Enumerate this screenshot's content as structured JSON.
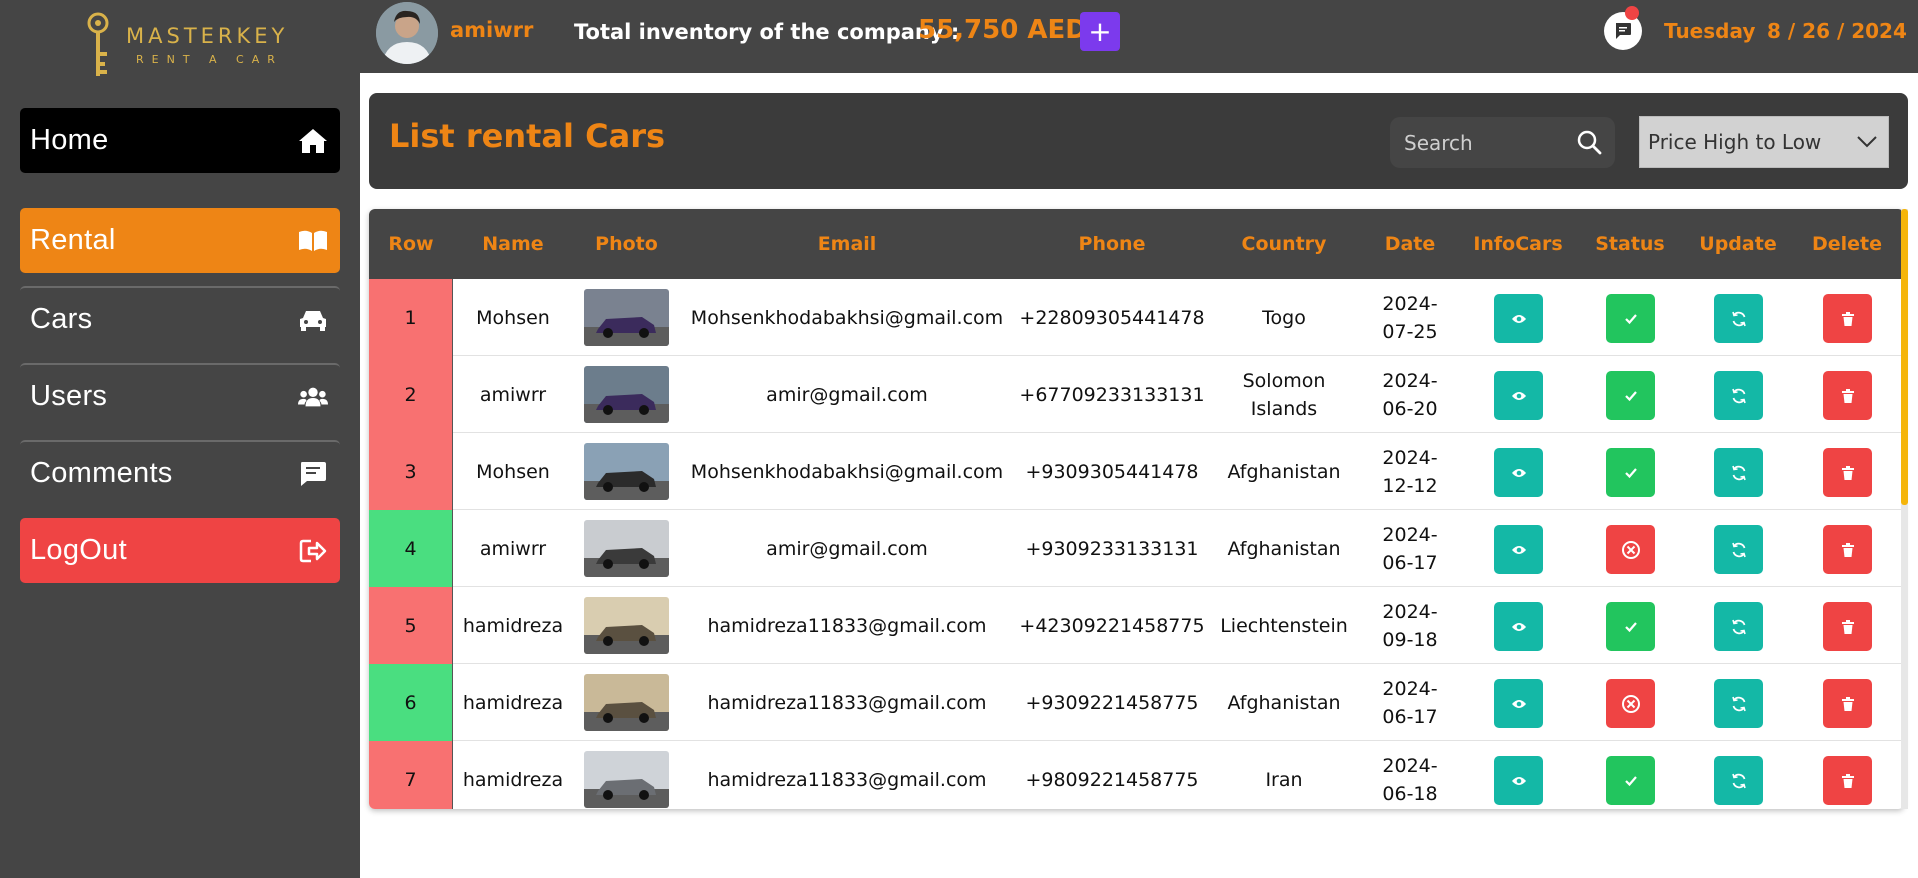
{
  "brand": {
    "name": "MASTERKEY",
    "tagline": "RENT A CAR"
  },
  "sidebar": {
    "items": [
      {
        "label": "Home",
        "icon": "home-icon"
      },
      {
        "label": "Rental",
        "icon": "book-open-icon"
      },
      {
        "label": "Cars",
        "icon": "car-icon"
      },
      {
        "label": "Users",
        "icon": "users-icon"
      },
      {
        "label": "Comments",
        "icon": "comment-icon"
      },
      {
        "label": "LogOut",
        "icon": "logout-icon"
      }
    ]
  },
  "topbar": {
    "username": "amiwrr",
    "inventory_label": "Total inventory of the company :",
    "inventory_value": "55,750 AED",
    "add_label": "+",
    "day": "Tuesday",
    "date": "8 / 26 / 2024"
  },
  "page": {
    "title": "List rental Cars",
    "search_placeholder": "Search",
    "sort_value": "Price High to Low"
  },
  "table": {
    "headers": [
      "Row",
      "Name",
      "Photo",
      "Email",
      "Phone",
      "Country",
      "Date",
      "InfoCars",
      "Status",
      "Update",
      "Delete"
    ],
    "rows": [
      {
        "row": "1",
        "name": "Mohsen",
        "email": "Mohsenkhodabakhsi@gmail.com",
        "phone": "+22809305441478",
        "country": "Togo",
        "date1": "2024-",
        "date2": "07-25",
        "status": "approved",
        "row_color": "#f87171"
      },
      {
        "row": "2",
        "name": "amiwrr",
        "email": "amir@gmail.com",
        "phone": "+67709233133131",
        "country": "Solomon Islands",
        "date1": "2024-",
        "date2": "06-20",
        "status": "approved",
        "row_color": "#f87171"
      },
      {
        "row": "3",
        "name": "Mohsen",
        "email": "Mohsenkhodabakhsi@gmail.com",
        "phone": "+9309305441478",
        "country": "Afghanistan",
        "date1": "2024-",
        "date2": "12-12",
        "status": "approved",
        "row_color": "#f87171"
      },
      {
        "row": "4",
        "name": "amiwrr",
        "email": "amir@gmail.com",
        "phone": "+9309233133131",
        "country": "Afghanistan",
        "date1": "2024-",
        "date2": "06-17",
        "status": "rejected",
        "row_color": "#4ade80"
      },
      {
        "row": "5",
        "name": "hamidreza",
        "email": "hamidreza11833@gmail.com",
        "phone": "+42309221458775",
        "country": "Liechtenstein",
        "date1": "2024-",
        "date2": "09-18",
        "status": "approved",
        "row_color": "#f87171"
      },
      {
        "row": "6",
        "name": "hamidreza",
        "email": "hamidreza11833@gmail.com",
        "phone": "+9309221458775",
        "country": "Afghanistan",
        "date1": "2024-",
        "date2": "06-17",
        "status": "rejected",
        "row_color": "#4ade80"
      },
      {
        "row": "7",
        "name": "hamidreza",
        "email": "hamidreza11833@gmail.com",
        "phone": "+9809221458775",
        "country": "Iran",
        "date1": "2024-",
        "date2": "06-18",
        "status": "approved",
        "row_color": "#f87171"
      }
    ]
  },
  "colors": {
    "accent": "#ee8515",
    "danger": "#ef4444",
    "success": "#22c55e",
    "info": "#14b8a6",
    "purple": "#7c3aed"
  }
}
